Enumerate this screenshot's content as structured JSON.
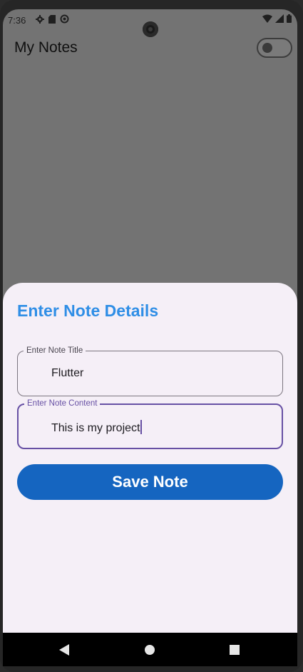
{
  "status_bar": {
    "time": "7:36",
    "left_icons": [
      "gear-icon",
      "sd-card-icon",
      "sync-icon"
    ],
    "right_icons": [
      "wifi-icon",
      "signal-icon",
      "battery-icon"
    ]
  },
  "app_bar": {
    "title": "My Notes",
    "theme_toggle_on": false
  },
  "sheet": {
    "title": "Enter Note Details",
    "title_field": {
      "label": "Enter Note Title",
      "value": "Flutter"
    },
    "content_field": {
      "label": "Enter Note Content",
      "value": "This is my project"
    },
    "save_label": "Save Note"
  },
  "nav_bar": {
    "icons": [
      "back-icon",
      "home-icon",
      "recents-icon"
    ]
  },
  "colors": {
    "accent_title": "#2f8ee6",
    "button": "#1565c0",
    "focus": "#6750a4",
    "sheet_bg": "#f5eff7",
    "scrim": "#737373"
  }
}
